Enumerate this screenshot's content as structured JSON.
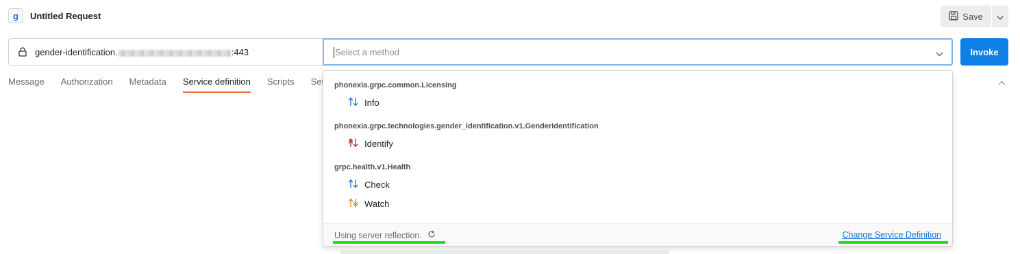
{
  "header": {
    "icon_letter": "g",
    "title": "Untitled Request",
    "save_label": "Save"
  },
  "url": {
    "host_prefix": "gender-identification.",
    "port_suffix": ":443"
  },
  "method_select": {
    "placeholder": "Select a method"
  },
  "invoke_label": "Invoke",
  "tabs": [
    {
      "label": "Message",
      "active": false
    },
    {
      "label": "Authorization",
      "active": false
    },
    {
      "label": "Metadata",
      "active": false
    },
    {
      "label": "Service definition",
      "active": true
    },
    {
      "label": "Scripts",
      "active": false
    },
    {
      "label": "Set",
      "active": false
    }
  ],
  "dropdown": {
    "services": [
      {
        "name": "phonexia.grpc.common.Licensing",
        "methods": [
          {
            "label": "Info",
            "icon": "unary-arrows-icon"
          }
        ]
      },
      {
        "name": "phonexia.grpc.technologies.gender_identification.v1.GenderIdentification",
        "methods": [
          {
            "label": "Identify",
            "icon": "client-streaming-arrows-icon"
          }
        ]
      },
      {
        "name": "grpc.health.v1.Health",
        "methods": [
          {
            "label": "Check",
            "icon": "unary-arrows-icon"
          },
          {
            "label": "Watch",
            "icon": "server-streaming-arrows-icon"
          }
        ]
      }
    ],
    "footer": {
      "reflection_text": "Using server reflection.",
      "change_link": "Change Service Definition"
    }
  },
  "colors": {
    "accent_blue": "#0f7fe6",
    "tab_underline": "#f26b3a",
    "highlight_green": "#1be21b",
    "unary_arrow": "#1a6fd8",
    "client_stream_arrow": "#b3261e",
    "server_stream_arrow": "#d9822b"
  }
}
